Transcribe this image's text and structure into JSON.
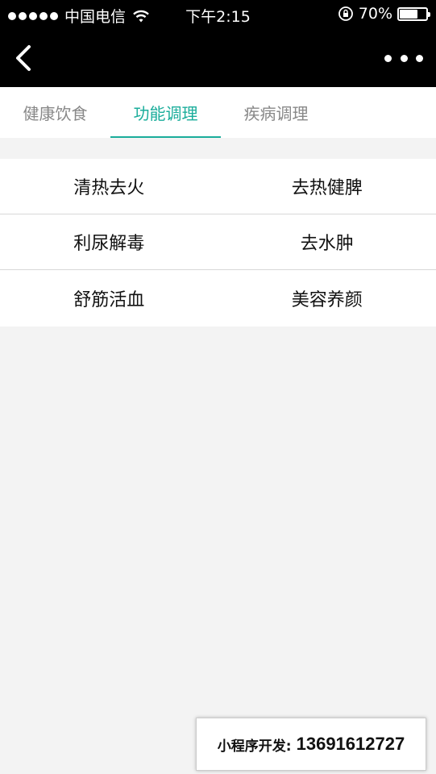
{
  "status_bar": {
    "carrier": "中国电信",
    "time": "下午2:15",
    "battery_percent_text": "70%",
    "battery_level": 0.7,
    "signal_dots": 5
  },
  "nav": {
    "back_icon": "chevron-left-icon",
    "more_icon": "more-dots-icon"
  },
  "tabs": [
    {
      "label": "健康饮食",
      "active": false
    },
    {
      "label": "功能调理",
      "active": true
    },
    {
      "label": "疾病调理",
      "active": false
    }
  ],
  "categories": [
    [
      "清热去火",
      "去热健脾"
    ],
    [
      "利尿解毒",
      "去水肿"
    ],
    [
      "舒筋活血",
      "美容养颜"
    ]
  ],
  "promo": {
    "label": "小程序开发:",
    "phone": "13691612727"
  },
  "colors": {
    "accent": "#1aad9b",
    "background": "#f3f3f3",
    "bar": "#000000"
  }
}
